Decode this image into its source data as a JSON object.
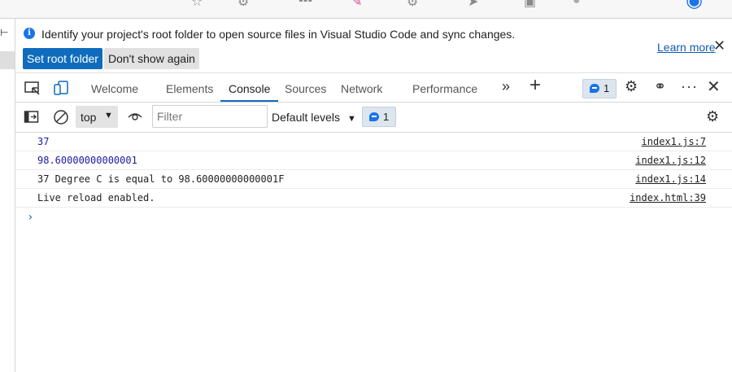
{
  "infobar": {
    "message": "Identify your project's root folder to open source files in Visual Studio Code and sync changes.",
    "set_root_label": "Set root folder",
    "dont_show_label": "Don't show again",
    "learn_more_label": "Learn more",
    "close_glyph": "✕"
  },
  "tabs": [
    {
      "label": "Welcome"
    },
    {
      "label": "Elements"
    },
    {
      "label": "Console",
      "active": true
    },
    {
      "label": "Sources"
    },
    {
      "label": "Network"
    },
    {
      "label": "Performance"
    }
  ],
  "issues_count": "1",
  "console_toolbar": {
    "context": "top",
    "filter_placeholder": "Filter",
    "levels_label": "Default levels",
    "issues_count": "1"
  },
  "console_rows": [
    {
      "message": "37",
      "source": "index1.js:7",
      "kind": "number"
    },
    {
      "message": "98.60000000000001",
      "source": "index1.js:12",
      "kind": "number"
    },
    {
      "message": "37 Degree C is equal to 98.60000000000001F",
      "source": "index1.js:14",
      "kind": "text"
    },
    {
      "message": "Live reload enabled.",
      "source": "index.html:39",
      "kind": "text"
    }
  ],
  "prompt_glyph": "›",
  "colors": {
    "accent": "#0f6cbd",
    "number": "#1a1aa6",
    "issue_blue": "#1a73e8"
  }
}
